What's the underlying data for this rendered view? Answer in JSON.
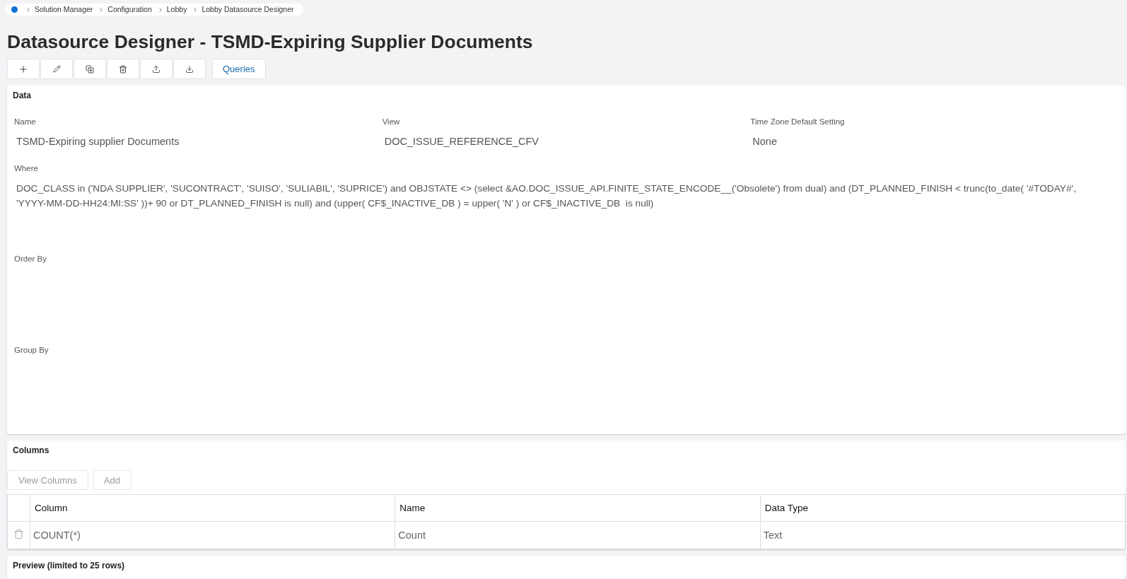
{
  "breadcrumb": {
    "items": [
      "Solution Manager",
      "Configuration",
      "Lobby",
      "Lobby Datasource Designer"
    ]
  },
  "page_title": "Datasource Designer - TSMD-Expiring Supplier Documents",
  "toolbar": {
    "icon_buttons": [
      {
        "kind": "add"
      },
      {
        "kind": "edit"
      },
      {
        "kind": "copy"
      },
      {
        "kind": "delete"
      },
      {
        "kind": "export"
      },
      {
        "kind": "import"
      }
    ],
    "queries_button": "Queries"
  },
  "data_panel": {
    "title": "Data",
    "fields": [
      {
        "label": "Name",
        "value": "TSMD-Expiring supplier Documents"
      },
      {
        "label": "View",
        "value": "DOC_ISSUE_REFERENCE_CFV"
      },
      {
        "label": "Time Zone Default Setting",
        "value": "None"
      }
    ],
    "where": {
      "label": "Where",
      "value": "DOC_CLASS in ('NDA SUPPLIER', 'SUCONTRACT', 'SUISO', 'SULIABIL', 'SUPRICE') and OBJSTATE <> (select &AO.DOC_ISSUE_API.FINITE_STATE_ENCODE__('Obsolete') from dual) and (DT_PLANNED_FINISH < trunc(to_date( '#TODAY#', 'YYYY-MM-DD-HH24:MI:SS' ))+ 90 or DT_PLANNED_FINISH is null) and (upper( CF$_INACTIVE_DB ) = upper( 'N' ) or CF$_INACTIVE_DB  is null)"
    },
    "order_by": {
      "label": "Order By"
    },
    "group_by": {
      "label": "Group By"
    }
  },
  "columns_panel": {
    "title": "Columns",
    "buttons": [
      {
        "label": "View Columns",
        "disabled": true
      },
      {
        "label": "Add",
        "disabled": true
      }
    ],
    "table": {
      "columns": [
        "Column",
        "Name",
        "Data Type"
      ],
      "rows": [
        {
          "cells": [
            "COUNT(*)",
            "Count",
            "Text"
          ]
        }
      ]
    }
  },
  "preview_panel": {
    "title": "Preview (limited to 25 rows)"
  }
}
